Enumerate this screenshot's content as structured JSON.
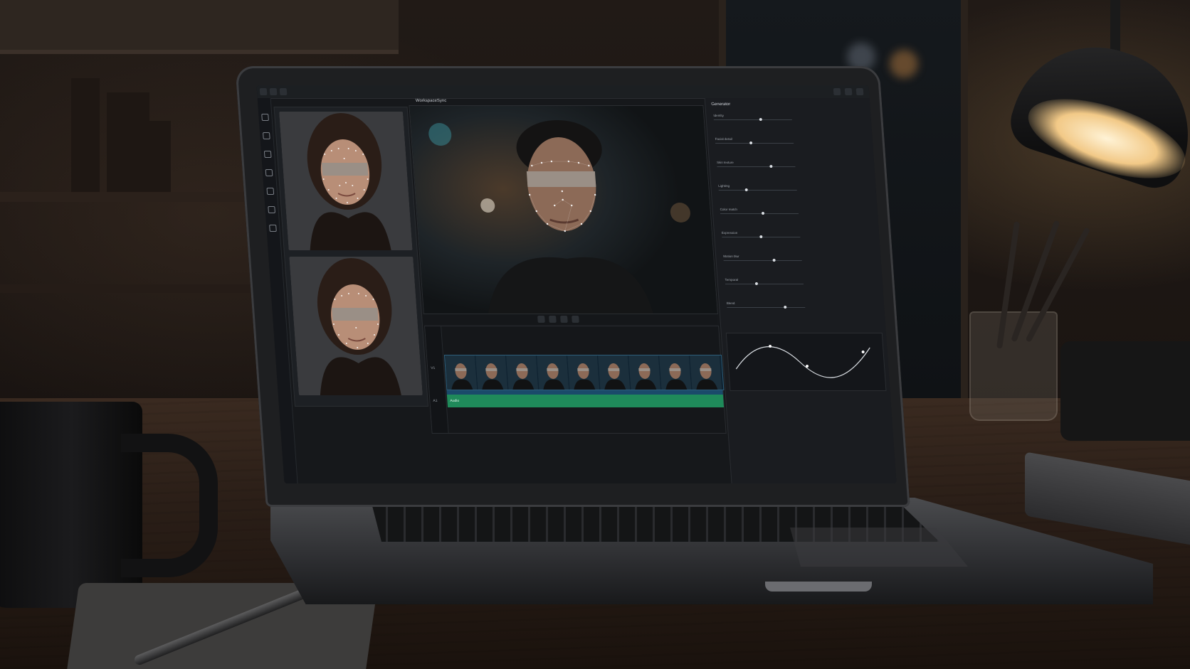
{
  "app": {
    "tabs": [
      {
        "label": "Workspace"
      },
      {
        "label": "Sync"
      }
    ],
    "panel_title": "Generator",
    "panel_rows": [
      {
        "label": "Identity"
      },
      {
        "label": "Facial detail"
      },
      {
        "label": "Skin texture"
      },
      {
        "label": "Lighting"
      },
      {
        "label": "Color match"
      },
      {
        "label": "Expression"
      },
      {
        "label": "Motion blur"
      },
      {
        "label": "Temporal"
      },
      {
        "label": "Blend"
      }
    ],
    "timeline": {
      "tracks": [
        {
          "label": "V1"
        },
        {
          "label": "A1"
        }
      ],
      "clip_count": 9,
      "audio_label": "Audio"
    }
  },
  "colors": {
    "audio_track": "#1f8a5a",
    "video_track": "#2e5e7a",
    "landmarks": "#ffffff",
    "eye_blur": "#9a8f86"
  }
}
